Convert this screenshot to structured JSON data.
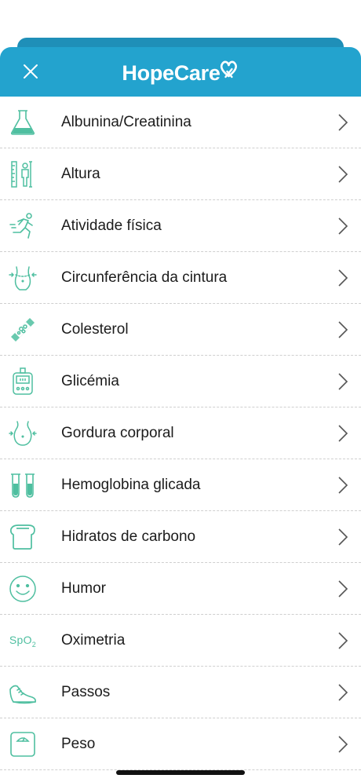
{
  "header": {
    "brand": "HopeCare",
    "accent_color": "#23a3ce",
    "close_icon": "close-icon"
  },
  "icon_color": "#4fbfa0",
  "items": [
    {
      "label": "Albunina/Creatinina",
      "icon": "flask-icon"
    },
    {
      "label": "Altura",
      "icon": "height-ruler-icon"
    },
    {
      "label": "Atividade física",
      "icon": "running-person-icon"
    },
    {
      "label": "Circunferência da cintura",
      "icon": "waist-measure-icon"
    },
    {
      "label": "Colesterol",
      "icon": "cholesterol-artery-icon"
    },
    {
      "label": "Glicémia",
      "icon": "glucometer-icon"
    },
    {
      "label": "Gordura corporal",
      "icon": "body-fat-icon"
    },
    {
      "label": "Hemoglobina glicada",
      "icon": "test-tubes-icon"
    },
    {
      "label": "Hidratos de carbono",
      "icon": "bread-icon"
    },
    {
      "label": "Humor",
      "icon": "smiley-icon"
    },
    {
      "label": "Oximetria",
      "icon": "spo2-icon",
      "icon_text": "SpO",
      "icon_sub": "2"
    },
    {
      "label": "Passos",
      "icon": "sneaker-icon"
    },
    {
      "label": "Peso",
      "icon": "scale-icon"
    }
  ]
}
